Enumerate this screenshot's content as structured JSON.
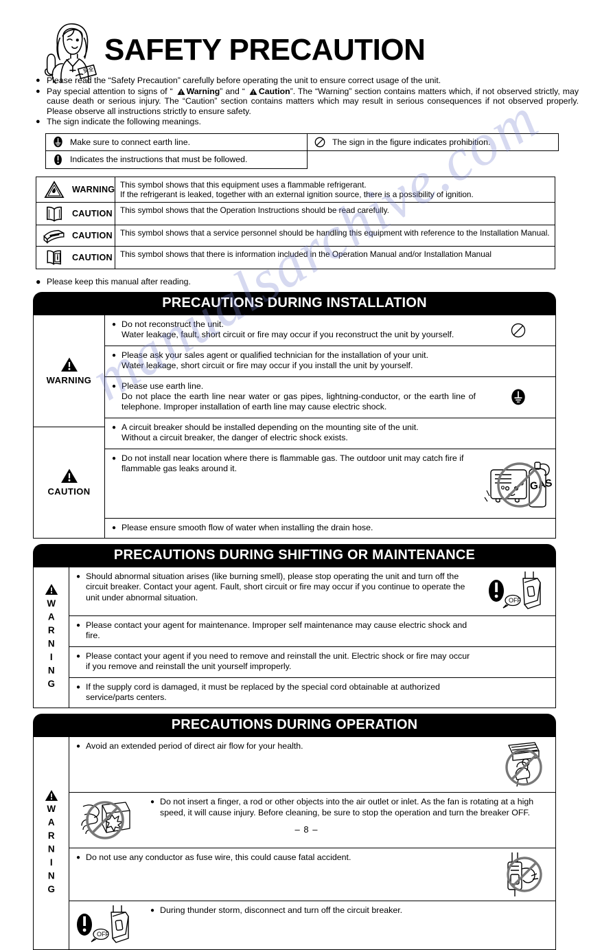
{
  "header": {
    "title": "SAFETY PRECAUTION",
    "mascot_icon": "woman-pointing-up-illustration"
  },
  "intro": {
    "bullets": [
      {
        "parts": [
          {
            "type": "text",
            "text": "Please read the “Safety Precaution” carefully before operating the unit to ensure correct usage of the unit."
          }
        ]
      },
      {
        "parts": [
          {
            "type": "text",
            "text": "Pay special attention to signs of “ "
          },
          {
            "type": "icon",
            "icon": "warning-triangle-icon"
          },
          {
            "type": "bold",
            "text": "Warning"
          },
          {
            "type": "text",
            "text": "” and “ "
          },
          {
            "type": "icon",
            "icon": "warning-triangle-icon"
          },
          {
            "type": "bold",
            "text": "Caution"
          },
          {
            "type": "text",
            "text": "”. The “Warning” section contains matters which, if not observed strictly, may cause death or serious injury. The “Caution” section contains matters which may result in serious consequences if not observed properly. Please observe all instructions strictly to ensure safety."
          }
        ]
      },
      {
        "parts": [
          {
            "type": "text",
            "text": "The sign indicate the following meanings."
          }
        ]
      }
    ],
    "bullet_glyph": "●"
  },
  "sign_legend": {
    "left": [
      {
        "icon": "earth-ground-filled-icon",
        "label": "Make sure to connect earth line."
      },
      {
        "icon": "exclamation-filled-oval-icon",
        "label": "Indicates the instructions that must be followed."
      }
    ],
    "right": [
      {
        "icon": "prohibition-circle-icon",
        "label": "The sign in the figure indicates prohibition."
      }
    ]
  },
  "symbol_table": {
    "rows": [
      {
        "icon": "flammable-warning-icon",
        "level": "WARNING",
        "text_lines": [
          "This symbol shows that this equipment uses a flammable refrigerant.",
          "If the refrigerant is leaked, together with an external ignition source, there is a possibility of ignition."
        ]
      },
      {
        "icon": "open-book-icon",
        "level": "CAUTION",
        "text_lines": [
          "This symbol shows that the Operation Instructions should be read carefully."
        ]
      },
      {
        "icon": "service-manual-icon",
        "level": "CAUTION",
        "text_lines": [
          "This symbol shows that a service personnel should be handling this equipment with reference to the Installation Manual."
        ]
      },
      {
        "icon": "information-book-icon",
        "level": "CAUTION",
        "text_lines": [
          "This symbol shows that there is information included in the Operation Manual and/or Installation Manual"
        ]
      }
    ]
  },
  "keep_manual": {
    "bullet_glyph": "●",
    "text": "Please keep this manual after reading."
  },
  "sections": [
    {
      "id": "installation",
      "banner": "PRECAUTIONS DURING INSTALLATION",
      "levels": [
        {
          "label": "WARNING",
          "icon": "warning-triangle-icon",
          "vertical": false,
          "rows": [
            {
              "text": "Do not reconstruct the unit.\nWater leakage, fault, short circuit or fire may occur if you reconstruct the unit by yourself.",
              "icon": "prohibition-circle-icon",
              "icon_side": "right"
            },
            {
              "text": "Please ask your sales agent or qualified technician for the installation of your unit.\nWater leakage, short circuit or fire may occur if you install the unit by yourself.",
              "icon": null,
              "icon_side": "right"
            },
            {
              "text": "Please use earth line.\nDo not place the earth line near water or gas pipes, lightning-conductor, or the earth line of telephone. Improper installation of earth line may cause electric shock.",
              "icon": "earth-ground-filled-icon",
              "icon_side": "right"
            }
          ]
        },
        {
          "label": "CAUTION",
          "icon": "warning-triangle-icon",
          "vertical": false,
          "rows": [
            {
              "text": "A circuit breaker should be installed depending on the mounting site of the unit.\nWithout a circuit breaker, the danger of electric shock exists.",
              "icon": null,
              "icon_side": "right"
            },
            {
              "text": "Do not install near location where there is flammable gas. The outdoor unit may catch fire if flammable gas leaks around it.",
              "icon": "no-flammable-gas-icon",
              "icon_side": "right"
            },
            {
              "text": "Please ensure smooth flow of water when installing the drain hose.",
              "icon": null,
              "icon_side": "right"
            }
          ]
        }
      ]
    },
    {
      "id": "shifting-maintenance",
      "banner": "PRECAUTIONS DURING SHIFTING OR MAINTENANCE",
      "levels": [
        {
          "label": "WARNING",
          "icon": "warning-triangle-icon",
          "vertical": true,
          "rows": [
            {
              "text": "Should abnormal situation arises (like burning smell), please stop operating the unit and turn off the circuit breaker. Contact your agent. Fault, short circuit or fire may occur if you continue to operate the unit under abnormal situation.",
              "icon": "turn-off-breaker-icon",
              "icon_side": "right"
            },
            {
              "text": "Please contact your agent for maintenance. Improper self maintenance may cause electric shock and fire.",
              "icon": null,
              "icon_side": "right"
            },
            {
              "text": "Please contact your agent if you need to remove and reinstall the unit. Electric shock or fire may occur if you remove and reinstall the unit yourself improperly.",
              "icon": null,
              "icon_side": "right"
            },
            {
              "text": "If the supply cord is damaged, it must be replaced by the special cord obtainable at authorized service/parts centers.",
              "icon": null,
              "icon_side": "right"
            }
          ]
        }
      ]
    },
    {
      "id": "operation",
      "banner": "PRECAUTIONS DURING OPERATION",
      "levels": [
        {
          "label": "WARNING",
          "icon": "warning-triangle-icon",
          "vertical": true,
          "rows": [
            {
              "text": "Avoid an extended period of direct air flow for your health.",
              "icon": "no-direct-airflow-icon",
              "icon_side": "right"
            },
            {
              "text": "Do not insert a finger, a rod or other objects into the air outlet or inlet. As the fan is rotating at a high speed, it will cause injury. Before cleaning, be sure to stop the operation and turn the breaker OFF.",
              "icon": "no-finger-in-outlet-icon",
              "icon_side": "left"
            },
            {
              "text": "Do not use any conductor as fuse wire, this could cause fatal accident.",
              "icon": "no-fuse-wire-icon",
              "icon_side": "right"
            },
            {
              "text": "During thunder storm, disconnect and turn off the circuit breaker.",
              "icon": "turn-off-breaker-icon",
              "icon_side": "left"
            }
          ]
        }
      ]
    }
  ],
  "footer": {
    "page_number": "– 8 –"
  },
  "watermark": {
    "text": "manualsarchive.com"
  },
  "colors": {
    "ink": "#000000",
    "paper": "#ffffff",
    "watermark": "#7882cd"
  }
}
